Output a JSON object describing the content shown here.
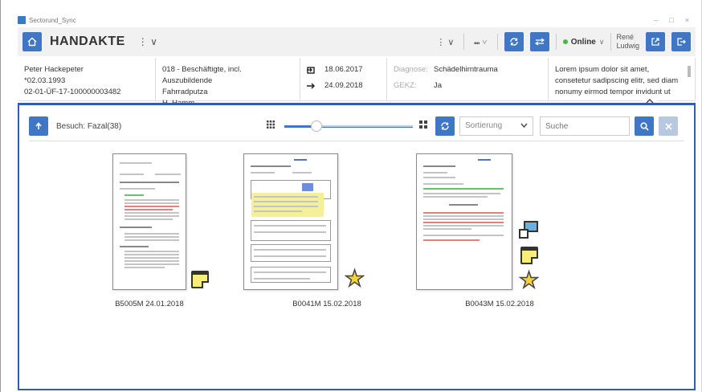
{
  "window": {
    "title": "Sectorund_Sync",
    "controls": [
      "–",
      "□",
      "×"
    ]
  },
  "header": {
    "title": "HANDAKTE",
    "menu_label": "⋮ ∨",
    "icons": [
      "home-icon",
      "more-vert-icon",
      "library-icon",
      "sync-icon",
      "transfer-icon",
      "external-link-icon",
      "logout-icon"
    ],
    "tools": {
      "more_label": "⋮ ∨",
      "library_label": "⑉ ∨"
    },
    "status": "Online",
    "status_caret": "∨",
    "user_first": "René",
    "user_last": "Ludwig"
  },
  "patient": {
    "name": "Peter Hackepeter",
    "birth": "*02.03.1993",
    "case_id": "02-01-ÜF-17-100000003482",
    "category": "018 - Beschäftigte, incl. Auszubildende",
    "job": "Fahrradputza",
    "doctor": "H. Hamm",
    "date_start": "18.06.2017",
    "date_end": "24.09.2018",
    "diagnosis_label": "Diagnose:",
    "diagnosis_value": "Schädelhirntrauma",
    "gekz_label": "GEKZ:",
    "gekz_value": "Ja",
    "note": "Lorem ipsum dolor sit amet, consetetur sadipscing elitr, sed diam nonumy eirmod tempor invidunt ut"
  },
  "toolbar": {
    "visit_label": "Besuch: Fazal(38)",
    "slider_value": 0.25,
    "sort_placeholder": "Sortierung",
    "search_placeholder": "Suche"
  },
  "documents": [
    {
      "label": "B5005M 24.01.2018",
      "has_note": true,
      "starred": false,
      "has_split": false
    },
    {
      "label": "B0041M 15.02.2018",
      "has_note": false,
      "starred": true,
      "has_split": false
    },
    {
      "label": "B0043M 15.02.2018",
      "has_note": true,
      "starred": true,
      "has_split": true
    }
  ],
  "colors": {
    "accent": "#3f77c4",
    "panel_border": "#2d62a8",
    "online": "#4bb543",
    "star": "#f3d23b",
    "note": "#f7ee7a"
  }
}
